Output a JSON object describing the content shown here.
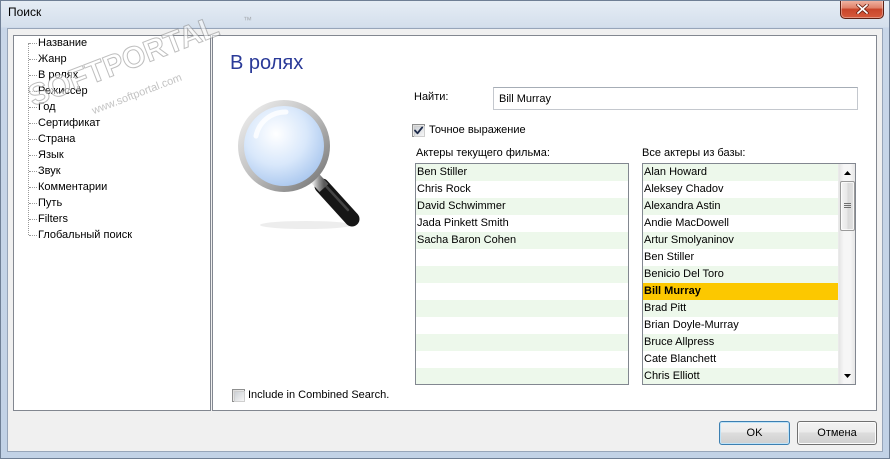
{
  "window": {
    "title": "Поиск"
  },
  "watermark": {
    "brand": "SOFTPORTAL",
    "trademark": "™",
    "url": "www.softportal.com"
  },
  "icons": {
    "close": "close-icon",
    "search": "magnifier-icon",
    "check": "checkmark-icon",
    "scroll_up": "arrow-up-icon",
    "scroll_down": "arrow-down-icon",
    "grip": "grip-icon"
  },
  "colors": {
    "heading": "#2a3a98",
    "list_row_alt": "#edf8eb",
    "list_row_selected": "#fcc800",
    "close_button": "#c8452a"
  },
  "tree": {
    "items": [
      "Название",
      "Жанр",
      "В ролях",
      "Режиссёр",
      "Год",
      "Сертификат",
      "Страна",
      "Язык",
      "Звук",
      "Комментарии",
      "Путь",
      "Filters",
      "Глобальный поиск"
    ]
  },
  "panel": {
    "heading": "В ролях",
    "search": {
      "label": "Найти:",
      "value": "Bill Murray"
    },
    "exact_match": {
      "label": "Точное выражение",
      "checked": true
    },
    "current_actors": {
      "label": "Актеры текущего фильма:",
      "items": [
        "Ben Stiller",
        "Chris Rock",
        "David Schwimmer",
        "Jada Pinkett Smith",
        "Sacha Baron Cohen"
      ]
    },
    "all_actors": {
      "label": "Все актеры из базы:",
      "items": [
        "Alan Howard",
        "Aleksey Chadov",
        "Alexandra Astin",
        "Andie MacDowell",
        "Artur Smolyaninov",
        "Ben Stiller",
        "Benicio Del Toro",
        "Bill Murray",
        "Brad Pitt",
        "Brian Doyle-Murray",
        "Bruce Allpress",
        "Cate Blanchett",
        "Chris Elliott"
      ],
      "selected_index": 7,
      "scroll": {
        "position": 0,
        "visible_fraction": 0.27
      }
    },
    "combined_search": {
      "label": "Include in Combined Search.",
      "checked": false
    }
  },
  "buttons": {
    "ok": "OK",
    "cancel": "Отмена"
  }
}
